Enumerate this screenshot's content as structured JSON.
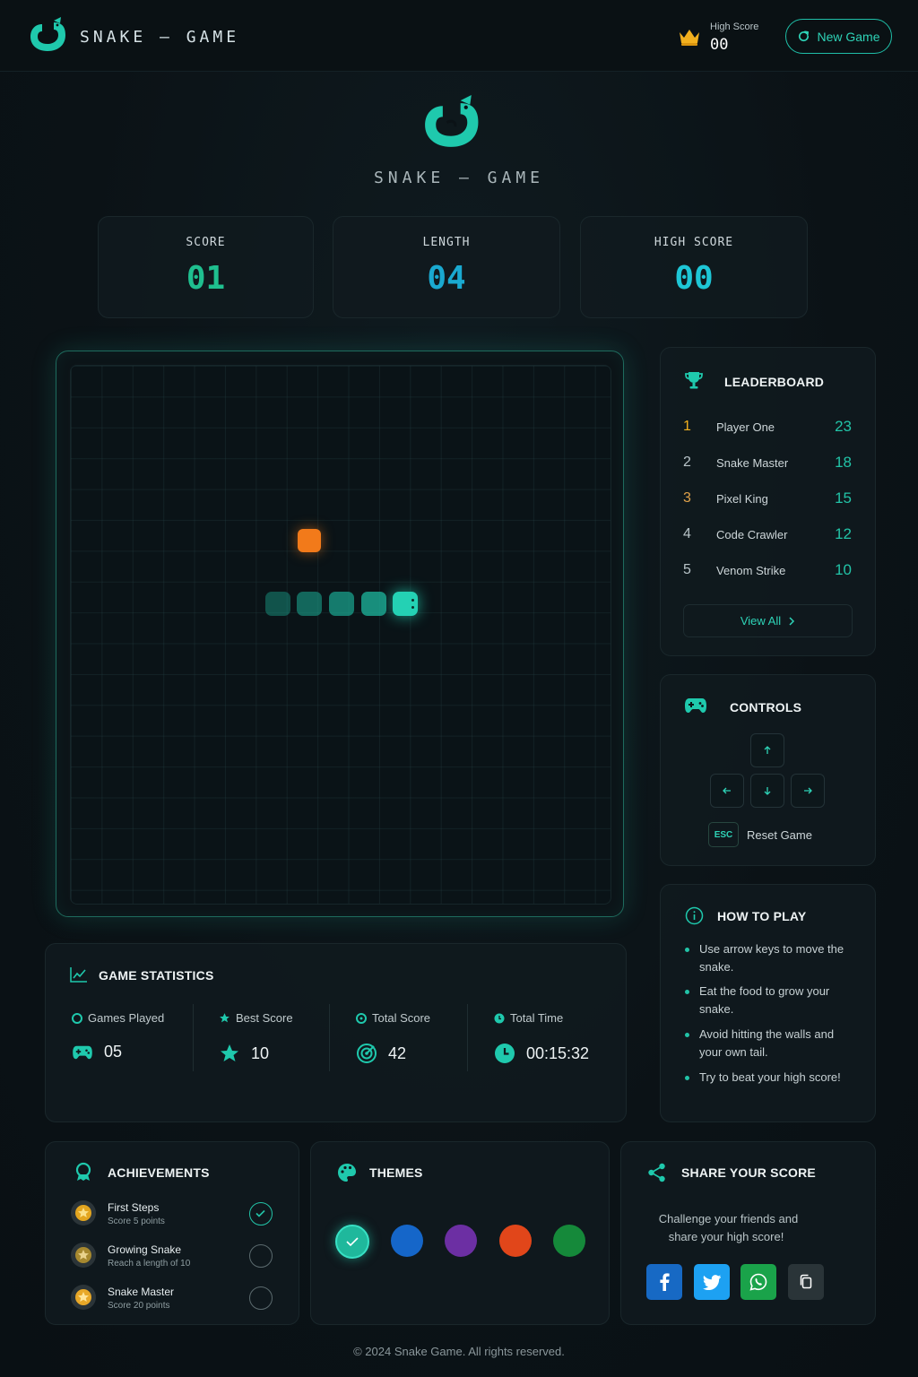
{
  "header": {
    "brand": "SNAKE — GAME",
    "high_score_label": "High Score",
    "high_score_value": "00",
    "new_game_label": "New Game"
  },
  "hero": {
    "title": "SNAKE — GAME"
  },
  "stats": [
    {
      "label": "SCORE",
      "value": "01",
      "color": "#1fbf8f"
    },
    {
      "label": "LENGTH",
      "value": "04",
      "color": "#1aa9d0"
    },
    {
      "label": "HIGH SCORE",
      "value": "00",
      "color": "#1ec6d6"
    }
  ],
  "board": {
    "grid_columns": 17,
    "grid_rows": 17,
    "food": {
      "col": 7,
      "row": 5
    },
    "snake": [
      {
        "col": 10,
        "row": 7,
        "head": true
      },
      {
        "col": 9,
        "row": 7
      },
      {
        "col": 8,
        "row": 7
      },
      {
        "col": 7,
        "row": 7
      },
      {
        "col": 6,
        "row": 7
      }
    ],
    "food_color": "#f27a1a",
    "snake_color": "#22c3a7"
  },
  "leaderboard": {
    "title": "LEADERBOARD",
    "rows": [
      {
        "rank": "1",
        "name": "Player One",
        "score": "23",
        "rank_color": "#f2b01e"
      },
      {
        "rank": "2",
        "name": "Snake Master",
        "score": "18",
        "rank_color": "#b8c4c8"
      },
      {
        "rank": "3",
        "name": "Pixel King",
        "score": "15",
        "rank_color": "#e0a24a"
      },
      {
        "rank": "4",
        "name": "Code Crawler",
        "score": "12",
        "rank_color": "#b8c4c8"
      },
      {
        "rank": "5",
        "name": "Venom Strike",
        "score": "10",
        "rank_color": "#b8c4c8"
      }
    ],
    "view_all_label": "View All"
  },
  "controls": {
    "title": "CONTROLS",
    "esc_label": "ESC",
    "reset_label": "Reset Game"
  },
  "how_to_play": {
    "title": "HOW TO PLAY",
    "items": [
      "Use arrow keys to move the snake.",
      "Eat the food to grow your snake.",
      "Avoid hitting the walls and your own tail.",
      "Try to beat your high score!"
    ]
  },
  "game_statistics": {
    "title": "GAME STATISTICS",
    "items": [
      {
        "label": "Games Played",
        "value": "05"
      },
      {
        "label": "Best Score",
        "value": "10"
      },
      {
        "label": "Total Score",
        "value": "42"
      },
      {
        "label": "Total Time",
        "value": "00:15:32"
      }
    ]
  },
  "achievements": {
    "title": "ACHIEVEMENTS",
    "items": [
      {
        "name": "First Steps",
        "desc": "Score 5 points",
        "done": true
      },
      {
        "name": "Growing Snake",
        "desc": "Reach a length of 10",
        "done": false
      },
      {
        "name": "Snake Master",
        "desc": "Score 20 points",
        "done": false
      }
    ]
  },
  "themes": {
    "title": "THEMES",
    "colors": [
      "#1fb89c",
      "#1566c9",
      "#6c2fa3",
      "#e1461a",
      "#15893a"
    ],
    "selected": 0
  },
  "share": {
    "title": "SHARE YOUR SCORE",
    "text_line1": "Challenge your friends and",
    "text_line2": "share your high score!",
    "buttons": [
      {
        "name": "facebook",
        "color": "#1769c4"
      },
      {
        "name": "twitter",
        "color": "#1da1f2"
      },
      {
        "name": "whatsapp",
        "color": "#1aa34a"
      },
      {
        "name": "copy",
        "color": "#2a3438"
      }
    ]
  },
  "footer": {
    "text": "© 2024 Snake Game. All rights reserved."
  }
}
